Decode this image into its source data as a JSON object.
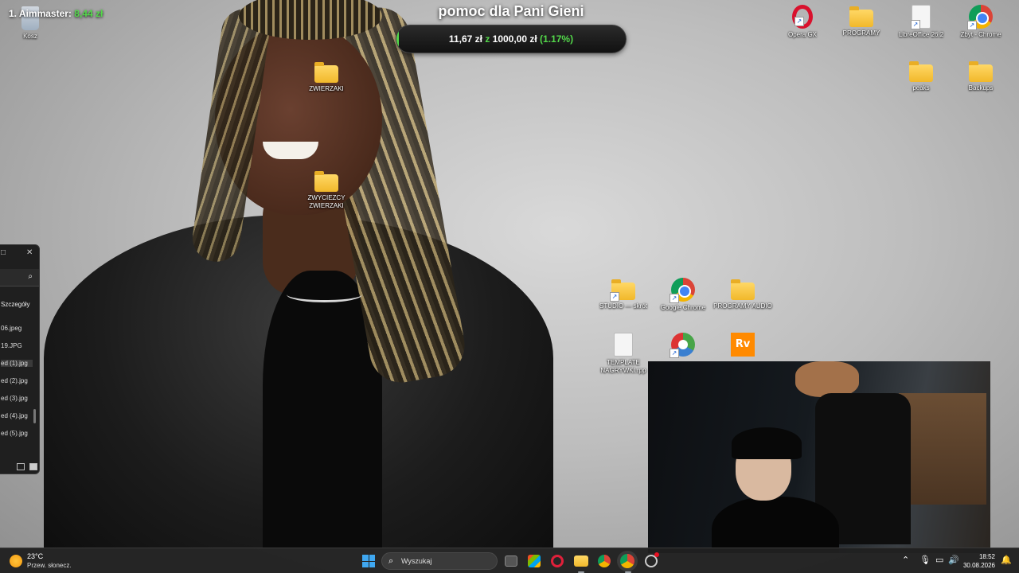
{
  "overlay": {
    "top_donor_label": "1. Aimmaster:",
    "top_donor_amount": "8,44 zł",
    "goal_title": "pomoc dla Pani Gieni",
    "goal_current": "11,67 zł",
    "goal_sep": "z",
    "goal_target": "1000,00 zł",
    "goal_percent": "(1.17%)",
    "goal_progress_fraction": 0.0117,
    "accent_color": "#53d84a"
  },
  "desktop": {
    "icons": [
      {
        "name": "desktop-icon-kosz",
        "label": "Kosz",
        "icon": "recycle-bin-icon"
      },
      {
        "name": "desktop-icon-zwierzaki",
        "label": "ZWIERZAKI",
        "icon": "folder-icon"
      },
      {
        "name": "desktop-icon-zwyciezcy",
        "label": "ZWYCIEZCY ZWIERZAKI",
        "icon": "folder-icon"
      },
      {
        "name": "desktop-icon-opera",
        "label": "Opera GX",
        "icon": "opera-gx-icon"
      },
      {
        "name": "desktop-icon-programy",
        "label": "PROGRAMY",
        "icon": "folder-icon"
      },
      {
        "name": "desktop-icon-libreoffice",
        "label": "LibreOffice 26.2",
        "icon": "libreoffice-icon"
      },
      {
        "name": "desktop-icon-zbyt-chrome",
        "label": "Zbyt - Chrome",
        "icon": "chrome-icon"
      },
      {
        "name": "desktop-icon-peaks",
        "label": "peaks",
        "icon": "folder-icon"
      },
      {
        "name": "desktop-icon-backups",
        "label": "Backups",
        "icon": "folder-icon"
      },
      {
        "name": "desktop-icon-studio",
        "label": "STUDIO — skrót",
        "icon": "folder-icon"
      },
      {
        "name": "desktop-icon-google-chrome",
        "label": "Google Chrome",
        "icon": "chrome-icon"
      },
      {
        "name": "desktop-icon-programy-audio",
        "label": "PROGRAMY AUDIO",
        "icon": "folder-icon"
      },
      {
        "name": "desktop-icon-template",
        "label": "TEMPLATE NAGRYWKI.rpp",
        "icon": "reaper-project-icon"
      },
      {
        "name": "desktop-icon-reaper",
        "label": "",
        "icon": "reaper-icon"
      },
      {
        "name": "desktop-icon-rv",
        "label": "",
        "icon": "rv-icon"
      }
    ]
  },
  "explorer": {
    "details_label": "Szczegóły",
    "files": [
      "06.jpeg",
      "19.JPG",
      "ed (1).jpg",
      "ed (2).jpg",
      "ed (3).jpg",
      "ed (4).jpg",
      "ed (5).jpg"
    ]
  },
  "taskbar": {
    "temperature": "23°C",
    "weather_desc": "Przew. słonecz.",
    "search_placeholder": "Wyszukaj",
    "time": "18:52",
    "date": "30.08.2026"
  }
}
